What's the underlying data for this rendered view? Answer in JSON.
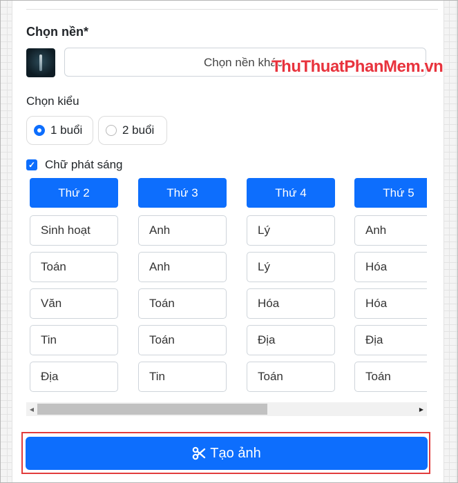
{
  "form": {
    "background_title": "Chọn nền*",
    "background_placeholder": "Chọn nền khác",
    "watermark": "ThuThuatPhanMem.vn",
    "style_label": "Chọn kiểu",
    "style_options": [
      {
        "label": "1 buổi",
        "checked": true
      },
      {
        "label": "2 buổi",
        "checked": false
      }
    ],
    "glow_text_label": "Chữ phát sáng",
    "glow_text_checked": true,
    "create_button_label": "Tạo ảnh",
    "create_button_icon": "scissors-icon"
  },
  "schedule": {
    "days": [
      {
        "name": "Thứ 2",
        "subjects": [
          "Sinh hoạt",
          "Toán",
          "Văn",
          "Tin",
          "Địa"
        ]
      },
      {
        "name": "Thứ 3",
        "subjects": [
          "Anh",
          "Anh",
          "Toán",
          "Toán",
          "Tin"
        ]
      },
      {
        "name": "Thứ 4",
        "subjects": [
          "Lý",
          "Lý",
          "Hóa",
          "Địa",
          "Toán"
        ]
      },
      {
        "name": "Thứ 5",
        "subjects": [
          "Anh",
          "Hóa",
          "Hóa",
          "Địa",
          "Toán"
        ]
      }
    ]
  },
  "colors": {
    "primary": "#0d6efd",
    "highlight_border": "#e23b3b",
    "watermark": "#e8333d"
  }
}
